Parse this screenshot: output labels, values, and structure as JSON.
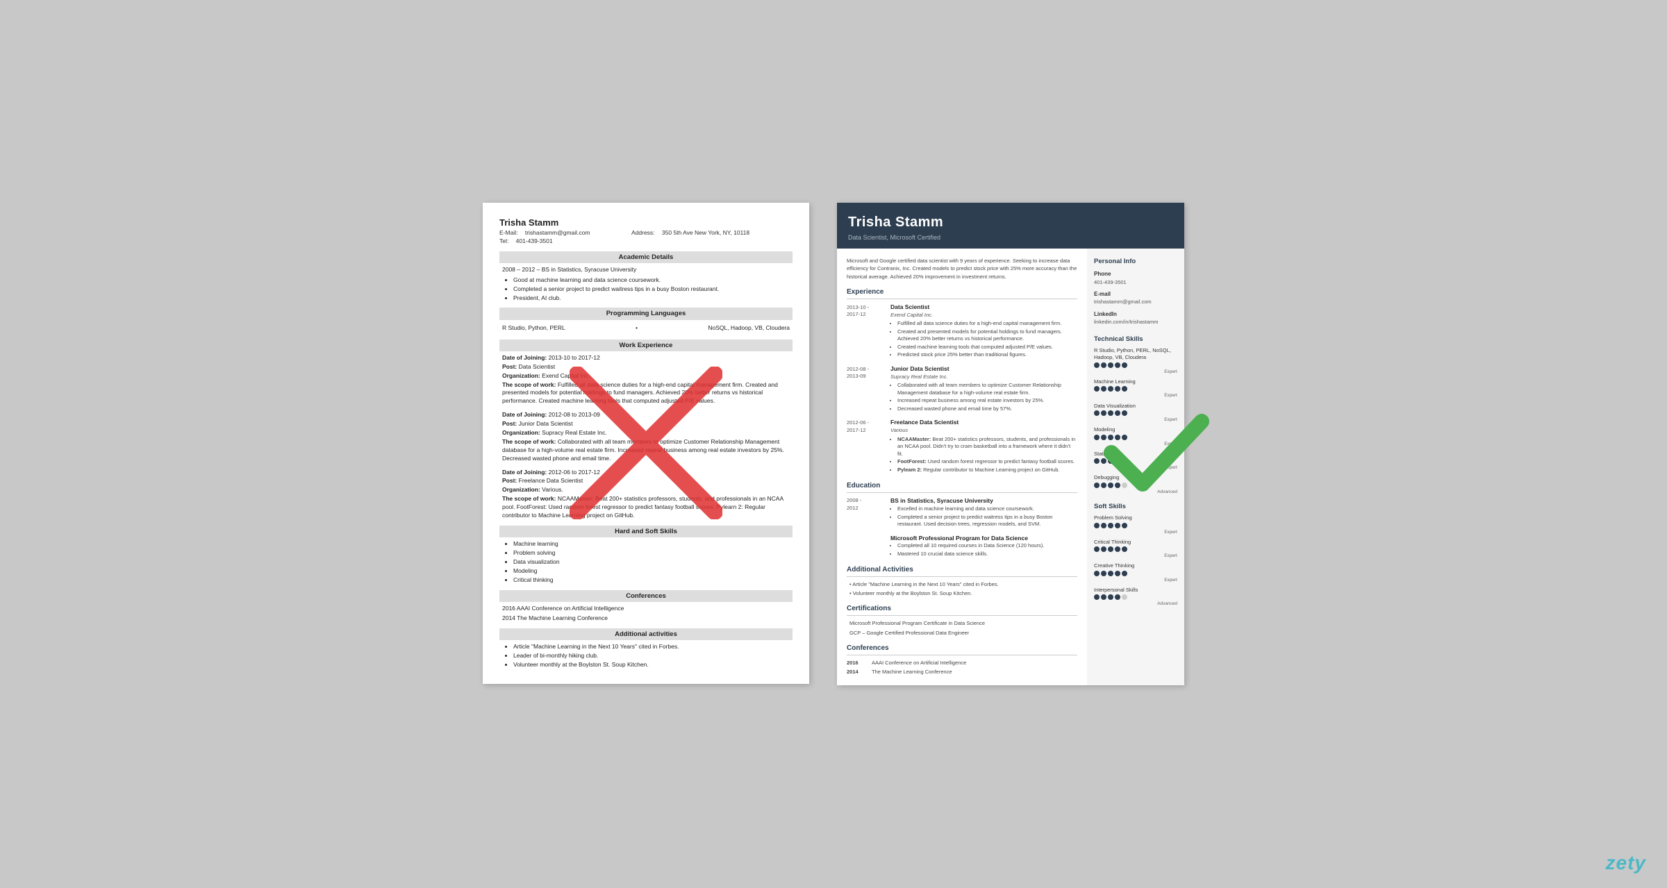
{
  "left_resume": {
    "name": "Trisha Stamm",
    "email_label": "E-Mail:",
    "email": "trishastamm@gmail.com",
    "address_label": "Address:",
    "address": "350 5th Ave New York, NY, 10118",
    "tel_label": "Tel:",
    "tel": "401-439-3501",
    "sections": {
      "academic": {
        "header": "Academic Details",
        "degree": "2008 – 2012 – BS in Statistics, Syracuse University",
        "bullets": [
          "Good at machine learning and data science coursework.",
          "Completed a senior project to predict waitress tips in a busy Boston restaurant.",
          "President, AI club."
        ]
      },
      "programming": {
        "header": "Programming Languages",
        "left": "R Studio, Python, PERL",
        "right": "NoSQL, Hadoop, VB, Cloudera"
      },
      "work": {
        "header": "Work Experience",
        "items": [
          {
            "date_label": "Date of Joining:",
            "date": "2013-10 to 2017-12",
            "post_label": "Post:",
            "post": "Data Scientist",
            "org_label": "Organization:",
            "org": "Exend Capital Inc.",
            "scope_label": "The scope of work:",
            "scope": "Fulfilled all data science duties for a high-end capital management firm. Created and presented models for potential holdings to fund managers. Achieved 20% better returns vs historical performance. Created machine learning tools that computed adjusted P/E values."
          },
          {
            "date_label": "Date of Joining:",
            "date": "2012-08 to 2013-09",
            "post_label": "Post:",
            "post": "Junior Data Scientist",
            "org_label": "Organization:",
            "org": "Supracy Real Estate Inc.",
            "scope_label": "The scope of work:",
            "scope": "Collaborated with all team members to optimize Customer Relationship Management database for a high-volume real estate firm. Increased repeat business among real estate investors by 25%. Decreased wasted phone and email time."
          },
          {
            "date_label": "Date of Joining:",
            "date": "2012-06 to 2017-12",
            "post_label": "Post:",
            "post": "Freelance Data Scientist",
            "org_label": "Organization:",
            "org": "Various.",
            "scope_label": "The scope of work:",
            "scope": "NCAAMaster: Beat 200+ statistics professors, students, and professionals in an NCAA pool. FootForest: Used random forest regressor to predict fantasy football scores. Pylearn 2: Regular contributor to Machine Learning project on GitHub."
          }
        ]
      },
      "skills": {
        "header": "Hard and Soft Skills",
        "bullets": [
          "Machine learning",
          "Problem solving",
          "Data visualization",
          "Modeling",
          "Critical thinking"
        ]
      },
      "conferences": {
        "header": "Conferences",
        "items": [
          "2016 AAAI Conference on Artificial Intelligence",
          "2014 The Machine Learning Conference"
        ]
      },
      "additional": {
        "header": "Additional activities",
        "bullets": [
          "Article \"Machine Learning in the Next 10 Years\" cited in Forbes.",
          "Leader of bi-monthly hiking club.",
          "Volunteer monthly at the Boylston St. Soup Kitchen."
        ]
      }
    }
  },
  "right_resume": {
    "name": "Trisha Stamm",
    "title": "Data Scientist, Microsoft Certified",
    "summary": "Microsoft and Google certified data scientist with 9 years of experience. Seeking to increase data efficiency for Contranix, Inc. Created models to predict stock price with 25% more accuracy than the historical average. Achieved 20% improvement in investment returns.",
    "sidebar": {
      "personal_info_title": "Personal Info",
      "phone_label": "Phone",
      "phone": "401-439-3501",
      "email_label": "E-mail",
      "email": "trishastamm@gmail.com",
      "linkedin_label": "LinkedIn",
      "linkedin": "linkedin.com/in/trishastamm",
      "tech_skills_title": "Technical Skills",
      "tech_skills": [
        {
          "name": "R Studio, Python, PERL, NoSQL,\nHadoop, VB, Cloudera",
          "dots": 5,
          "total": 5,
          "level": "Expert"
        },
        {
          "name": "Machine Learning",
          "dots": 5,
          "total": 5,
          "level": "Expert"
        },
        {
          "name": "Data Visualization",
          "dots": 5,
          "total": 5,
          "level": "Expert"
        },
        {
          "name": "Modeling",
          "dots": 5,
          "total": 5,
          "level": "Expert"
        },
        {
          "name": "Statistics",
          "dots": 4,
          "total": 5,
          "level": "Expert"
        },
        {
          "name": "Debugging",
          "dots": 4,
          "total": 5,
          "level": "Advanced"
        }
      ],
      "soft_skills_title": "Soft Skills",
      "soft_skills": [
        {
          "name": "Problem Solving",
          "dots": 5,
          "total": 5,
          "level": "Expert"
        },
        {
          "name": "Critical Thinking",
          "dots": 5,
          "total": 5,
          "level": "Expert"
        },
        {
          "name": "Creative Thinking",
          "dots": 5,
          "total": 5,
          "level": "Expert"
        },
        {
          "name": "Interpersonal Skills",
          "dots": 4,
          "total": 5,
          "level": "Advanced"
        }
      ]
    },
    "experience_title": "Experience",
    "experience": [
      {
        "date": "2013-10 -\n2017-12",
        "title": "Data Scientist",
        "company": "Exend Capital Inc.",
        "bullets": [
          "Fulfilled all data science duties for a high-end capital management firm.",
          "Created and presented models for potential holdings to fund managers. Achieved 20% better returns vs historical performance.",
          "Created machine learning tools that computed adjusted P/E values.",
          "Predicted stock price 25% better than traditional figures."
        ]
      },
      {
        "date": "2012-08 -\n2013-09",
        "title": "Junior Data Scientist",
        "company": "Supracy Real Estate Inc.",
        "bullets": [
          "Collaborated with all team members to optimize Customer Relationship Management database for a high-volume real estate firm.",
          "Increased repeat business among real estate investors by 25%.",
          "Decreased wasted phone and email time by 57%."
        ]
      },
      {
        "date": "2012-06 -\n2017-12",
        "title": "Freelance Data Scientist",
        "company": "Various",
        "bullets": [
          "NCAAMaster: Beat 200+ statistics professors, students, and professionals in an NCAA pool. Didn't try to cram basketball into a framework where it didn't fit.",
          "FootForest: Used random forest regressor to predict fantasy football scores.",
          "Pyleam 2: Regular contributor to Machine Learning project on GitHub."
        ]
      }
    ],
    "education_title": "Education",
    "education": [
      {
        "date": "2008 -\n2012",
        "degree": "BS in Statistics, Syracuse University",
        "bullets": [
          "Excelled in machine learning and data science coursework.",
          "Completed a senior project to predict waitress tips in a busy Boston restaurant. Used decision trees, regression models, and SVM."
        ]
      },
      {
        "date": "",
        "degree": "Microsoft Professional Program for Data Science",
        "bullets": [
          "Completed all 10 required courses in Data Science (120 hours).",
          "Mastered 10 crucial data science skills."
        ]
      }
    ],
    "additional_title": "Additional Activities",
    "additional_bullets": [
      "Article \"Machine Learning in the Next 10 Years\" cited in Forbes.",
      "Volunteer monthly at the Boylston St. Soup Kitchen."
    ],
    "certifications_title": "Certifications",
    "certifications": [
      "Microsoft Professional Program Certificate in Data Science",
      "GCP – Google Certified Professional Data Engineer"
    ],
    "conferences_title": "Conferences",
    "conferences": [
      {
        "year": "2016",
        "name": "AAAI Conference on Artificial Intelligence"
      },
      {
        "year": "2014",
        "name": "The Machine Learning Conference"
      }
    ]
  },
  "zety": "zety"
}
